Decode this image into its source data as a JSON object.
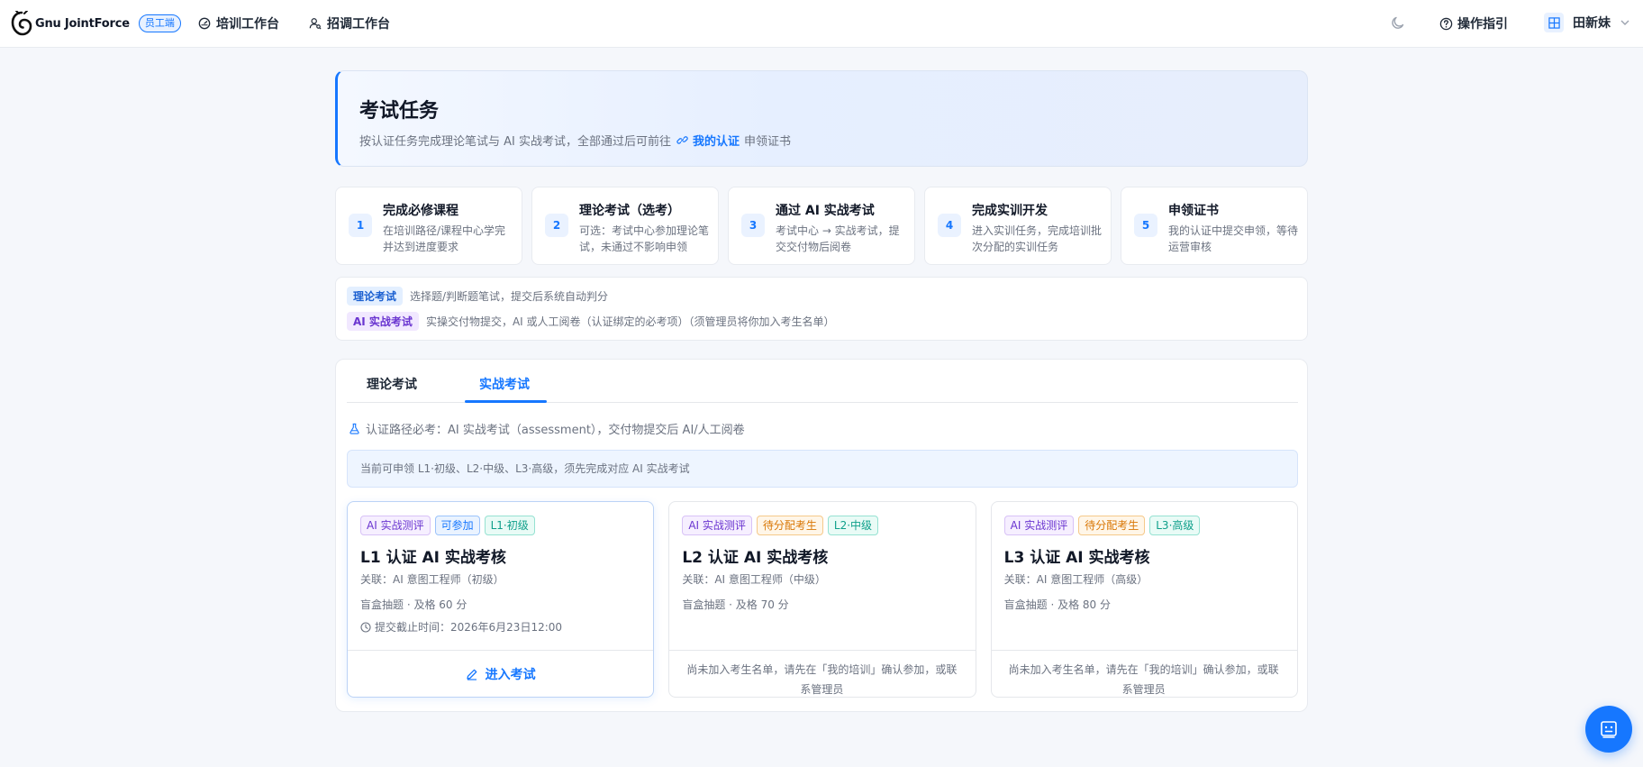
{
  "nav": {
    "brand": "Gnu JointForce",
    "role_badge": "员工端",
    "items": [
      {
        "label": "培训工作台",
        "icon": "dashboard-icon"
      },
      {
        "label": "招调工作台",
        "icon": "user-search-icon"
      }
    ],
    "guide": "操作指引",
    "user_name": "田新妹"
  },
  "hero": {
    "title": "考试任务",
    "subtitle_prefix": "按认证任务完成理论笔试与 AI 实战考试，全部通过后可前往",
    "link": "我的认证",
    "subtitle_suffix": "申领证书"
  },
  "steps": [
    {
      "num": "1",
      "title": "完成必修课程",
      "desc": "在培训路径/课程中心学完并达到进度要求"
    },
    {
      "num": "2",
      "title": "理论考试（选考）",
      "desc": "可选：考试中心参加理论笔试，未通过不影响申领"
    },
    {
      "num": "3",
      "title": "通过 AI 实战考试",
      "desc": "考试中心 → 实战考试，提交交付物后阅卷"
    },
    {
      "num": "4",
      "title": "完成实训开发",
      "desc": "进入实训任务，完成培训批次分配的实训任务"
    },
    {
      "num": "5",
      "title": "申领证书",
      "desc": "我的认证中提交申领，等待运营审核"
    }
  ],
  "legend": {
    "theory_tag": "理论考试",
    "theory_desc": "选择题/判断题笔试，提交后系统自动判分",
    "practice_tag": "AI 实战考试",
    "practice_desc": "实操交付物提交，AI 或人工阅卷（认证绑定的必考项）（须管理员将你加入考生名单）"
  },
  "tabs": [
    {
      "label": "理论考试",
      "active": false
    },
    {
      "label": "实战考试",
      "active": true
    }
  ],
  "requirement": "认证路径必考：AI 实战考试（assessment），交付物提交后 AI/人工阅卷",
  "notice": "当前可申领 L1·初级、L2·中级、L3·高级，须先完成对应 AI 实战考试",
  "cards": [
    {
      "chips": [
        {
          "label": "AI 实战测评",
          "color": "purple"
        },
        {
          "label": "可参加",
          "color": "blue"
        },
        {
          "label": "L1·初级",
          "color": "teal"
        }
      ],
      "title": "L1 认证 AI 实战考核",
      "related": "关联：AI 意图工程师（初级）",
      "rule": "盲盒抽题 · 及格 60 分",
      "deadline": "提交截止时间：2026年6月23日12:00",
      "action": "进入考试"
    },
    {
      "chips": [
        {
          "label": "AI 实战测评",
          "color": "purple"
        },
        {
          "label": "待分配考生",
          "color": "orange"
        },
        {
          "label": "L2·中级",
          "color": "teal"
        }
      ],
      "title": "L2 认证 AI 实战考核",
      "related": "关联：AI 意图工程师（中级）",
      "rule": "盲盒抽题 · 及格 70 分",
      "footer_msg": "尚未加入考生名单，请先在「我的培训」确认参加，或联系管理员"
    },
    {
      "chips": [
        {
          "label": "AI 实战测评",
          "color": "purple"
        },
        {
          "label": "待分配考生",
          "color": "orange"
        },
        {
          "label": "L3·高级",
          "color": "teal"
        }
      ],
      "title": "L3 认证 AI 实战考核",
      "related": "关联：AI 意图工程师（高级）",
      "rule": "盲盒抽题 · 及格 80 分",
      "footer_msg": "尚未加入考生名单，请先在「我的培训」确认参加，或联系管理员"
    }
  ],
  "colors": {
    "accent": "#1677ff",
    "background": "#f5f7fb"
  }
}
